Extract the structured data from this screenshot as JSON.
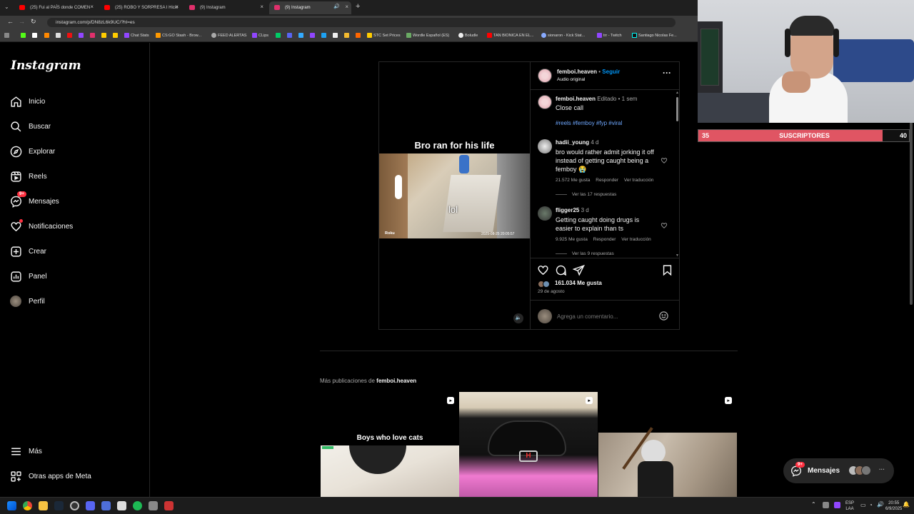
{
  "browser": {
    "tabs": [
      {
        "label": "(25) Fui al PAÍS donde COMEN",
        "color": "#ff0000"
      },
      {
        "label": "(25) ROBO Y SORPRESA I Hicie",
        "color": "#ff0000"
      },
      {
        "label": "(9) Instagram",
        "color": "#e1306c"
      },
      {
        "label": "(9) Instagram",
        "color": "#e1306c"
      }
    ],
    "new_tab": "+",
    "url": "instagram.com/p/DN8zL6k9UC/?hl=es",
    "bookmarks": [
      "Chat Stats",
      "CS:GO Stash - Brow...",
      "FEED ALERTAS",
      "CLips",
      "STC Set Prices",
      "Wordle Español (ES)",
      "Boludle",
      "TAN BIONICA EN EL...",
      "sionaron - Kick Stat...",
      "trr - Twitch",
      "Santiago Nicolas Fe..."
    ]
  },
  "sidebar": {
    "logo": "Instagram",
    "items": [
      {
        "label": "Inicio",
        "icon": "home-icon"
      },
      {
        "label": "Buscar",
        "icon": "search-icon"
      },
      {
        "label": "Explorar",
        "icon": "compass-icon"
      },
      {
        "label": "Reels",
        "icon": "reels-icon"
      },
      {
        "label": "Mensajes",
        "icon": "messenger-icon",
        "badge": "9+"
      },
      {
        "label": "Notificaciones",
        "icon": "heart-icon"
      },
      {
        "label": "Crear",
        "icon": "plus-square-icon"
      },
      {
        "label": "Panel",
        "icon": "chart-icon"
      },
      {
        "label": "Perfil",
        "icon": "avatar"
      }
    ],
    "bottom": [
      {
        "label": "Más",
        "icon": "menu-icon"
      },
      {
        "label": "Otras apps de Meta",
        "icon": "grid-icon"
      }
    ]
  },
  "post": {
    "media_title": "Bro ran for his life",
    "video_text": "lol",
    "video_brand": "Roku",
    "video_timestamp": "2025-08-25 20:05:57",
    "header": {
      "username": "femboi.heaven",
      "follow": "Seguir",
      "separator": "•",
      "audio": "Audio original"
    },
    "caption": {
      "username": "femboi.heaven",
      "edited": "Editado",
      "time": "1 sem",
      "text": "Close call",
      "tags": "#reels #femboy #fyp #viral"
    },
    "comments": [
      {
        "username": "hadii_young",
        "time": "4 d",
        "text": "bro would rather admit jorking it off instead of getting caught being a femboy 😭",
        "likes": "21.572 Me gusta",
        "reply": "Responder",
        "translate": "Ver traducción",
        "replies": "Ver las 17 respuestas"
      },
      {
        "username": "fligger25",
        "time": "3 d",
        "text": "Getting caught doing drugs is easier to explain than ts",
        "likes": "9.925 Me gusta",
        "reply": "Responder",
        "translate": "Ver traducción",
        "replies": "Ver las 9 respuestas"
      }
    ],
    "likes": "161.034 Me gusta",
    "date": "29 de agosto",
    "comment_placeholder": "Agrega un comentario..."
  },
  "more_posts": {
    "prefix": "Más publicaciones de",
    "username": "femboi.heaven",
    "thumb1_text": "Boys who love cats"
  },
  "stream": {
    "subs_left": "35",
    "subs_label": "SUSCRIPTORES",
    "subs_right": "40",
    "subs_progress": 0.875
  },
  "messages_pill": {
    "label": "Mensajes",
    "badge": "9+",
    "more": "···"
  },
  "taskbar": {
    "lang1": "ESP",
    "lang2": "LAA",
    "time": "20:55",
    "date": "6/9/2025"
  },
  "colors": {
    "accent": "#0095f6",
    "badge": "#ff3040",
    "subs_bar": "#e05563"
  }
}
